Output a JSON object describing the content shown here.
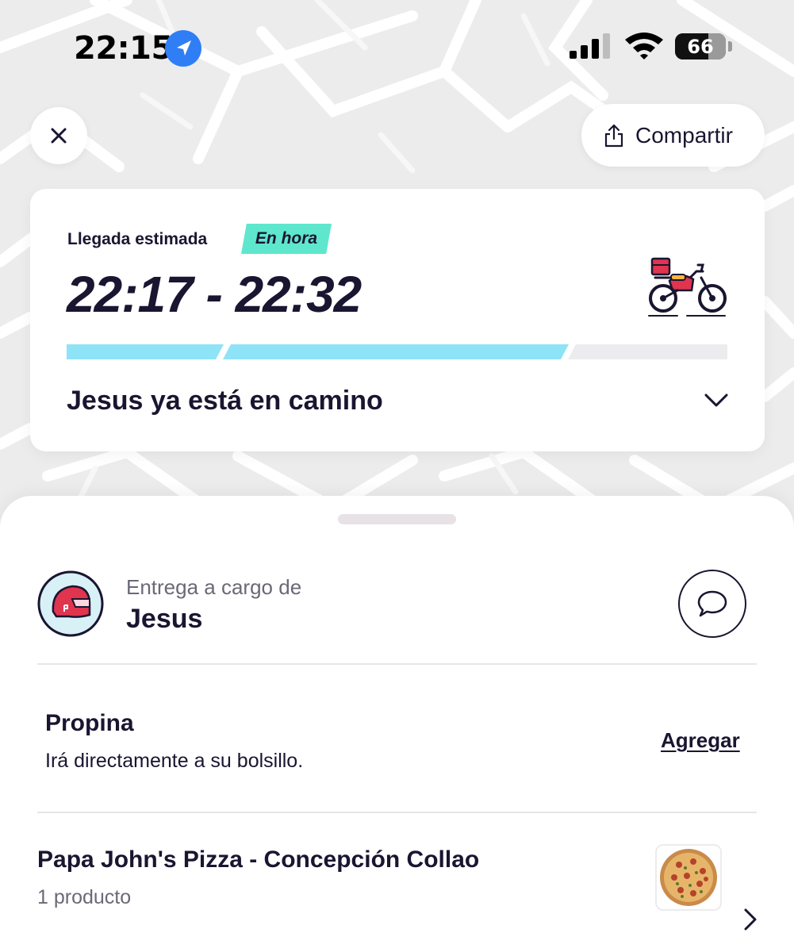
{
  "status_bar": {
    "time": "22:15",
    "battery_percent": 66,
    "battery_label": "66",
    "icons": [
      "location-arrow-icon",
      "cellular-signal-icon",
      "wifi-icon",
      "battery-icon"
    ]
  },
  "header": {
    "close_icon": "close-icon",
    "share_label": "Compartir",
    "share_icon": "share-icon"
  },
  "eta_card": {
    "label": "Llegada estimada",
    "badge": "En hora",
    "time_range": "22:17 - 22:32",
    "status": "Jesus ya está en camino",
    "progress_steps": [
      {
        "fraction": 1.0
      },
      {
        "fraction": 1.0
      },
      {
        "fraction": 0.0
      }
    ],
    "icon": "delivery-motorbike-icon"
  },
  "courier": {
    "delivery_by_label": "Entrega a cargo de",
    "name": "Jesus",
    "avatar_icon": "helmet-icon",
    "chat_icon": "chat-bubble-icon"
  },
  "tip": {
    "title": "Propina",
    "description": "Irá directamente a su bolsillo.",
    "action": "Agregar"
  },
  "order": {
    "store": "Papa John's Pizza - Concepción Collao",
    "count": "1 producto",
    "thumbnail_icon": "pizza-icon"
  },
  "colors": {
    "primary_text": "#1a1530",
    "badge_green": "#5ee7cd",
    "progress_blue": "#8ee3f7",
    "progress_empty": "#ececee",
    "location_blue": "#2f7ef5",
    "accent_red": "#e0344f"
  }
}
